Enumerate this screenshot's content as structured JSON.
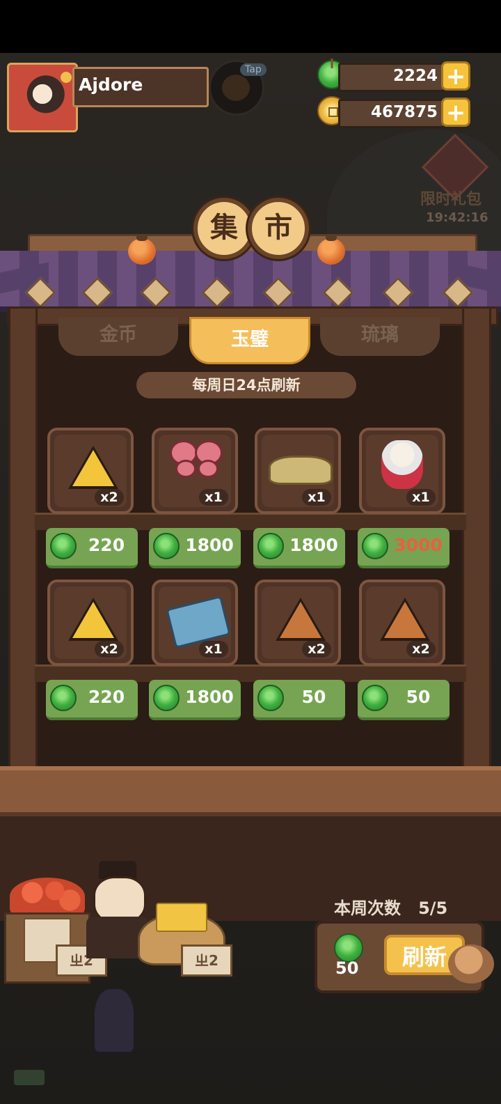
{
  "player": {
    "name": "Ajdore"
  },
  "tap_label": "Tap",
  "currencies": [
    {
      "icon": "jade-icon",
      "amount": "2224"
    },
    {
      "icon": "gold-coin-icon",
      "amount": "467875"
    }
  ],
  "plus_label": "+",
  "limited_gift": {
    "label": "限时礼包",
    "timer": "19:42:16"
  },
  "title_chars": [
    "集",
    "市"
  ],
  "tabs": [
    {
      "label": "金币",
      "active": false
    },
    {
      "label": "玉璧",
      "active": true
    },
    {
      "label": "琉璃",
      "active": false
    }
  ],
  "refresh_note": "每周日24点刷新",
  "items": [
    {
      "icon": "gold-triangle-token-icon",
      "qty": "x2",
      "price": "220",
      "affordable": true
    },
    {
      "icon": "butterfly-hairpin-icon",
      "qty": "x1",
      "price": "1800",
      "affordable": true
    },
    {
      "icon": "embroidered-shoes-icon",
      "qty": "x1",
      "price": "1800",
      "affordable": true
    },
    {
      "icon": "chibi-character-icon",
      "qty": "x1",
      "price": "3000",
      "affordable": false
    },
    {
      "icon": "gold-triangle-token-icon",
      "qty": "x2",
      "price": "220",
      "affordable": true
    },
    {
      "icon": "painted-book-icon",
      "qty": "x1",
      "price": "1800",
      "affordable": true
    },
    {
      "icon": "bronze-triangle-token-icon",
      "qty": "x2",
      "price": "50",
      "affordable": true
    },
    {
      "icon": "bronze-triangle-token-icon",
      "qty": "x2",
      "price": "50",
      "affordable": true
    }
  ],
  "weekly": {
    "label": "本周次数",
    "count": "5/5"
  },
  "refresh": {
    "cost": "50",
    "button_label": "刷新"
  },
  "stall_signs": [
    "ㄓ2",
    "ㄓ2"
  ]
}
